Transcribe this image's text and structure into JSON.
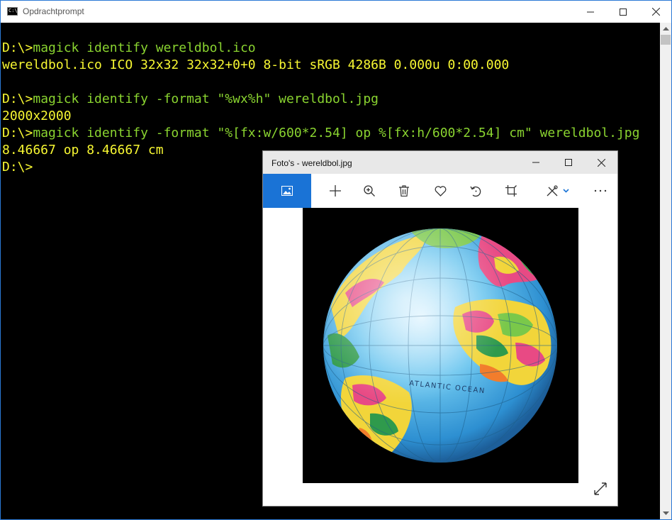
{
  "console": {
    "title": "Opdrachtprompt",
    "lines": [
      {
        "prompt": "D:\\>",
        "text": "magick identify wereldbol.ico"
      },
      {
        "output": "wereldbol.ico ICO 32x32 32x32+0+0 8-bit sRGB 4286B 0.000u 0:00.000"
      },
      {
        "prompt": "D:\\>",
        "text": "magick identify -format \"%wx%h\" wereldbol.jpg"
      },
      {
        "output": "2000x2000"
      },
      {
        "prompt": "D:\\>",
        "text": "magick identify -format \"%[fx:w/600*2.54] op %[fx:h/600*2.54] cm\" wereldbol.jpg"
      },
      {
        "output": "8.46667 op 8.46667 cm"
      },
      {
        "prompt": "D:\\>",
        "text": ""
      }
    ],
    "icon_label": "C:\\",
    "colors": {
      "prompt": "#f8f832",
      "command": "#8ad430",
      "output": "#f8f832"
    }
  },
  "photos": {
    "title": "Foto's - wereldbol.jpg",
    "toolbar": [
      "image-icon",
      "plus-icon",
      "zoom-in-icon",
      "delete-icon",
      "heart-icon",
      "rotate-icon",
      "crop-icon",
      "edit-icon",
      "more-icon"
    ],
    "globe_label": "ATLANTIC OCEAN",
    "accent": "#1a73d6"
  }
}
